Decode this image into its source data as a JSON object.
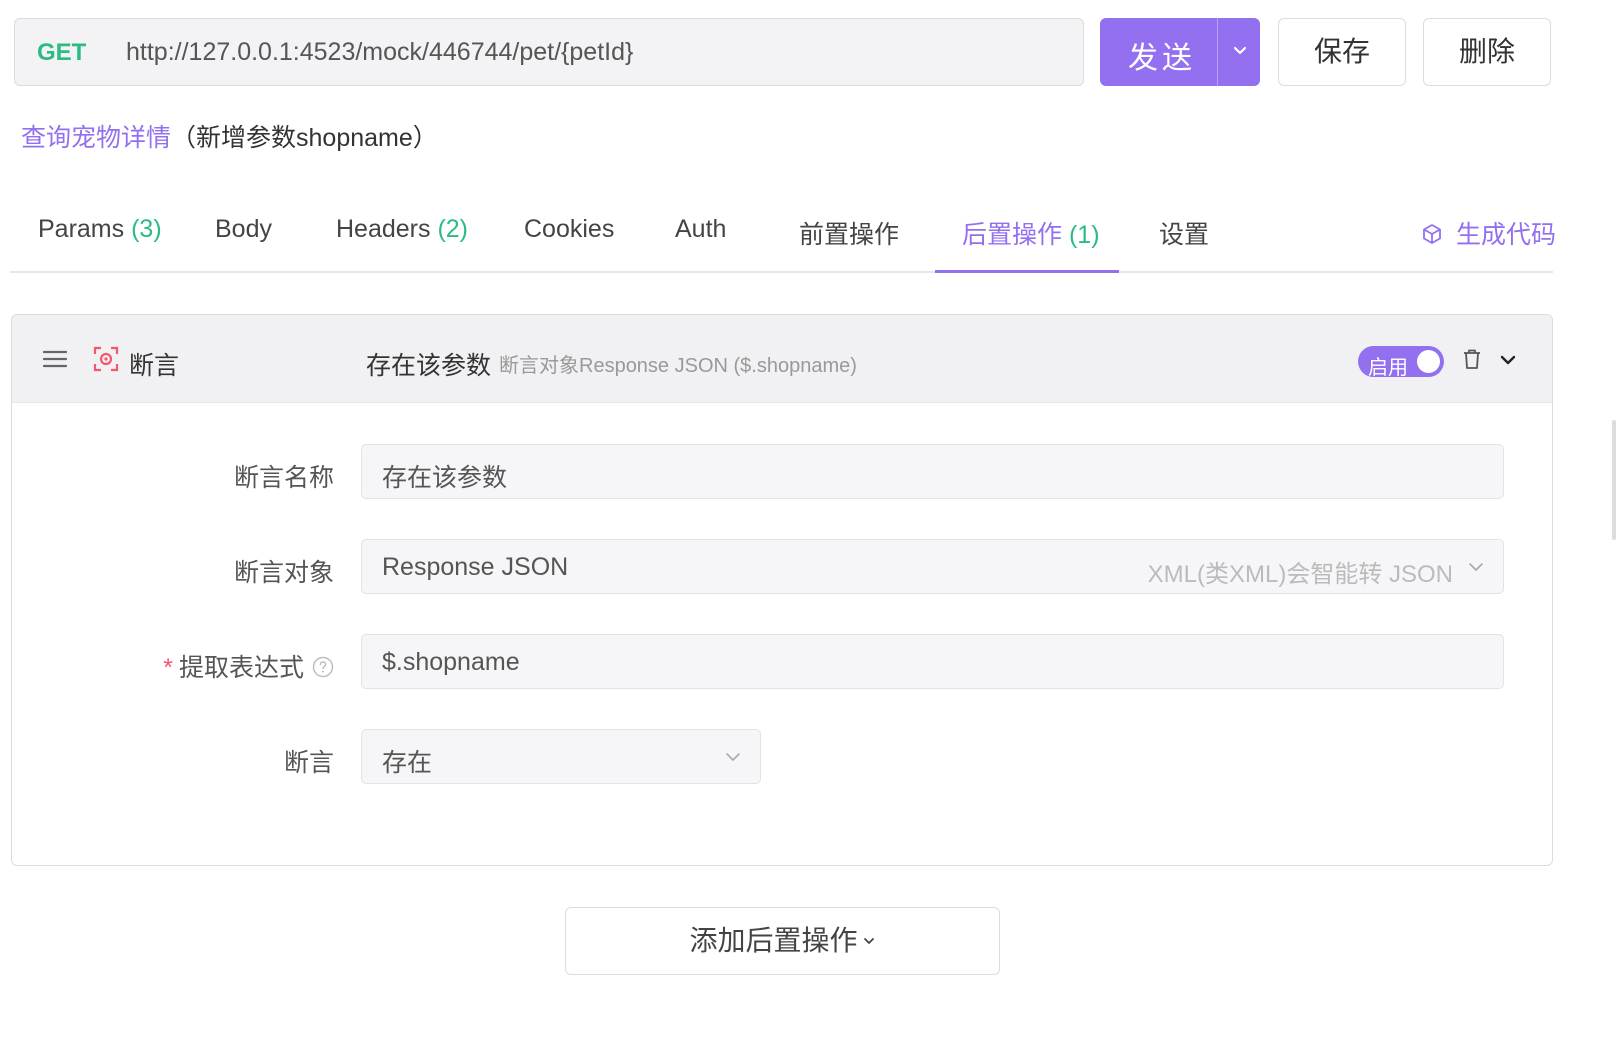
{
  "request": {
    "method": "GET",
    "url": "http://127.0.0.1:4523/mock/446744/pet/{petId}",
    "send_label": "发送",
    "save_label": "保存",
    "delete_label": "删除"
  },
  "api": {
    "name": "查询宠物详情",
    "note": "（新增参数shopname）"
  },
  "tabs": [
    {
      "label": "Params",
      "count": "(3)"
    },
    {
      "label": "Body",
      "count": ""
    },
    {
      "label": "Headers",
      "count": "(2)"
    },
    {
      "label": "Cookies",
      "count": ""
    },
    {
      "label": "Auth",
      "count": ""
    },
    {
      "label": "前置操作",
      "count": ""
    },
    {
      "label": "后置操作",
      "count": "(1)",
      "active": true
    },
    {
      "label": "设置",
      "count": ""
    }
  ],
  "gen_code_label": "生成代码",
  "assertion": {
    "type_label": "断言",
    "name": "存在该参数",
    "summary": "断言对象Response JSON ($.shopname)",
    "enabled_label": "启用",
    "enabled": true,
    "fields": {
      "name_label": "断言名称",
      "name_value": "存在该参数",
      "target_label": "断言对象",
      "target_value": "Response JSON",
      "target_hint": "XML(类XML)会智能转 JSON",
      "expr_required": "*",
      "expr_label": "提取表达式",
      "expr_value": "$.shopname",
      "assert_label": "断言",
      "assert_value": "存在"
    }
  },
  "add_post_op_label": "添加后置操作",
  "colors": {
    "accent": "#9370ef",
    "method_get": "#2dbb83",
    "count": "#2dbb83",
    "required": "#f5576c"
  },
  "icons": [
    "chevron-down-icon",
    "code-cube-icon",
    "drag-handle-icon",
    "assertion-icon",
    "trash-icon",
    "help-icon"
  ]
}
